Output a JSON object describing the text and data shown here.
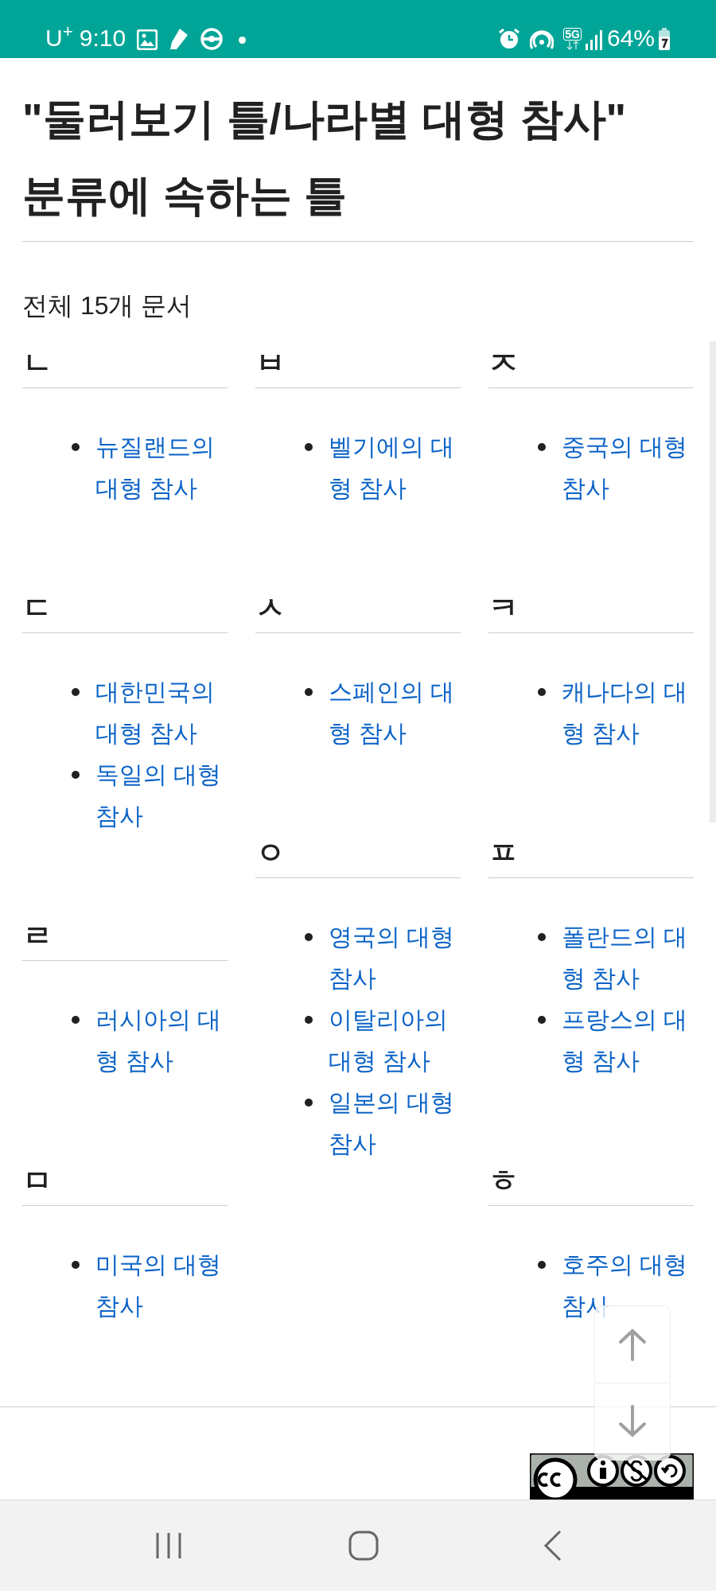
{
  "status_bar": {
    "carrier": "U$^{+}$",
    "time": "9:10",
    "network": "5G",
    "battery": "64%"
  },
  "title": "\"둘러보기 틀/나라별 대형 참사\" 분류에 속하는 틀",
  "count": "전체 15개 문서",
  "columns": [
    {
      "groups": [
        {
          "letter": "ㄴ",
          "items": [
            "뉴질랜드의 대형 참사"
          ]
        },
        {
          "letter": "ㄷ",
          "items": [
            "대한민국의 대형 참사",
            "독일의 대형 참사"
          ]
        },
        {
          "letter": "ㄹ",
          "items": [
            "러시아의 대형 참사"
          ]
        },
        {
          "letter": "ㅁ",
          "items": [
            "미국의 대형 참사"
          ]
        }
      ]
    },
    {
      "groups": [
        {
          "letter": "ㅂ",
          "items": [
            "벨기에의 대형 참사"
          ]
        },
        {
          "letter": "ㅅ",
          "items": [
            "스페인의 대형 참사"
          ]
        },
        {
          "letter": "ㅇ",
          "items": [
            "영국의 대형 참사",
            "이탈리아의 대형 참사",
            "일본의 대형 참사"
          ]
        }
      ]
    },
    {
      "groups": [
        {
          "letter": "ㅈ",
          "items": [
            "중국의 대형 참사"
          ]
        },
        {
          "letter": "ㅋ",
          "items": [
            "캐나다의 대형 참사"
          ]
        },
        {
          "letter": "ㅍ",
          "items": [
            "폴란드의 대형 참사",
            "프랑스의 대형 참사"
          ]
        },
        {
          "letter": "ㅎ",
          "items": [
            "호주의 대형 참사"
          ]
        }
      ]
    }
  ]
}
